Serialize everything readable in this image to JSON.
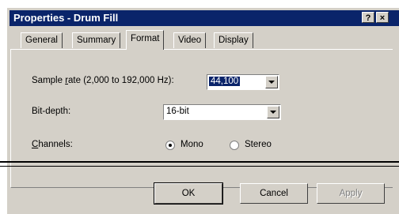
{
  "window": {
    "title": "Properties - Drum Fill",
    "help_label": "?",
    "close_label": "×"
  },
  "tabs": [
    {
      "label": "General",
      "active": false
    },
    {
      "label": "Summary",
      "active": false
    },
    {
      "label": "Format",
      "active": true
    },
    {
      "label": "Video",
      "active": false
    },
    {
      "label": "Display",
      "active": false
    }
  ],
  "format": {
    "sample_rate_label_prefix": "Sample ",
    "sample_rate_label_accel": "r",
    "sample_rate_label_suffix": "ate (2,000 to 192,000 Hz):",
    "sample_rate_value": "44,100",
    "bit_depth_label": "Bit-depth:",
    "bit_depth_value": "16-bit",
    "channels_label_accel": "C",
    "channels_label_suffix": "hannels:",
    "channels_options": [
      {
        "label": "Mono",
        "selected": true
      },
      {
        "label": "Stereo",
        "selected": false
      }
    ]
  },
  "buttons": {
    "ok": "OK",
    "cancel": "Cancel",
    "apply": "Apply"
  }
}
